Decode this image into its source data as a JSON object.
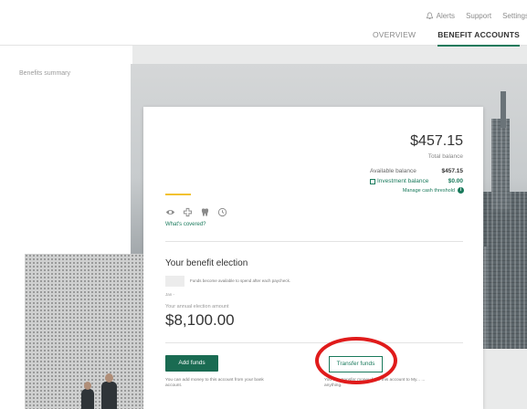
{
  "header": {
    "alerts_label": "Alerts",
    "support_label": "Support",
    "settings_label": "Settings",
    "tabs": [
      {
        "label": "OVERVIEW",
        "active": false
      },
      {
        "label": "BENEFIT ACCOUNTS",
        "active": true
      }
    ]
  },
  "sidebar": {
    "title": "Benefits summary"
  },
  "account": {
    "total_balance": "$457.15",
    "total_balance_label": "Total balance",
    "available_label": "Available balance",
    "available_value": "$457.15",
    "investment_label": "Investment balance",
    "investment_value": "$0.00",
    "manage_label": "Manage cash threshold",
    "whats_covered": "What's covered?",
    "icons": [
      "eye-icon",
      "medical-cross-icon",
      "tooth-icon",
      "clock-icon"
    ]
  },
  "election": {
    "title": "Your benefit election",
    "note": "Funds become available to spend after each paycheck.",
    "date": "Jan -",
    "annual_label": "Your annual election amount",
    "annual_value": "$8,100.00"
  },
  "actions": {
    "add_label": "Add funds",
    "add_help": "You can add money to this account from your bank account.",
    "transfer_label": "Transfer funds",
    "transfer_help": "You can transfer money from this account to My... ... anything."
  },
  "colors": {
    "accent": "#1a7a5c",
    "highlight": "#e01b1b",
    "progress": "#f2c230"
  }
}
